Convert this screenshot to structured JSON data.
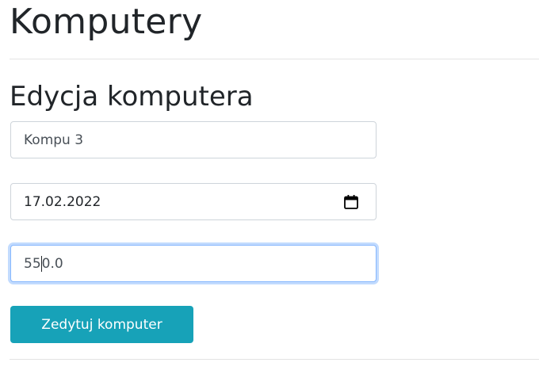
{
  "header": {
    "title": "Komputery"
  },
  "form": {
    "heading": "Edycja komputera",
    "name_value": "Kompu 3",
    "date_value": "17.02.2022",
    "price_value_before_caret": "55",
    "price_value_after_caret": "0.0",
    "submit_label": "Zedytuj komputer"
  },
  "icons": {
    "date_picker": "calendar-icon"
  },
  "colors": {
    "button_bg": "#17a2b8",
    "focus_border": "#86b7fe"
  }
}
